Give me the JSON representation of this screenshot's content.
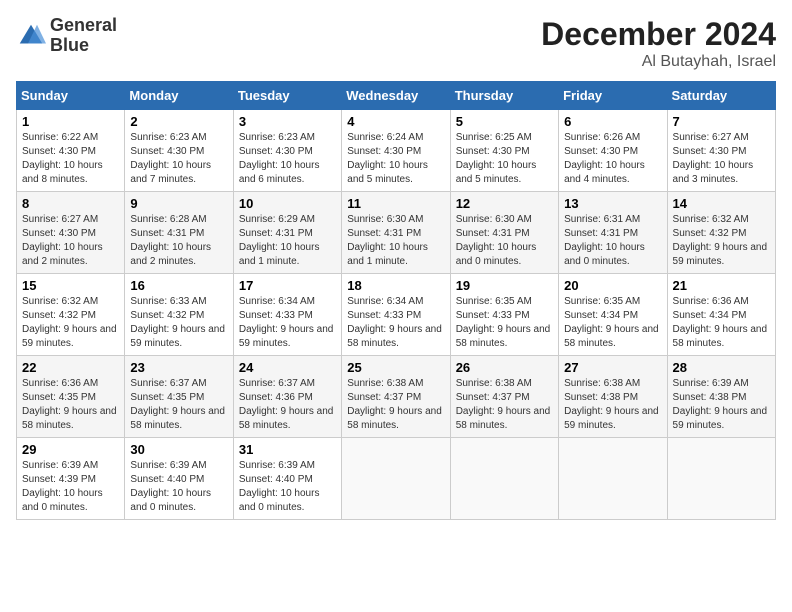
{
  "header": {
    "logo_line1": "General",
    "logo_line2": "Blue",
    "month_year": "December 2024",
    "location": "Al Butayhah, Israel"
  },
  "days_of_week": [
    "Sunday",
    "Monday",
    "Tuesday",
    "Wednesday",
    "Thursday",
    "Friday",
    "Saturday"
  ],
  "weeks": [
    [
      {
        "day": "1",
        "sunrise": "6:22 AM",
        "sunset": "4:30 PM",
        "daylight": "10 hours and 8 minutes."
      },
      {
        "day": "2",
        "sunrise": "6:23 AM",
        "sunset": "4:30 PM",
        "daylight": "10 hours and 7 minutes."
      },
      {
        "day": "3",
        "sunrise": "6:23 AM",
        "sunset": "4:30 PM",
        "daylight": "10 hours and 6 minutes."
      },
      {
        "day": "4",
        "sunrise": "6:24 AM",
        "sunset": "4:30 PM",
        "daylight": "10 hours and 5 minutes."
      },
      {
        "day": "5",
        "sunrise": "6:25 AM",
        "sunset": "4:30 PM",
        "daylight": "10 hours and 5 minutes."
      },
      {
        "day": "6",
        "sunrise": "6:26 AM",
        "sunset": "4:30 PM",
        "daylight": "10 hours and 4 minutes."
      },
      {
        "day": "7",
        "sunrise": "6:27 AM",
        "sunset": "4:30 PM",
        "daylight": "10 hours and 3 minutes."
      }
    ],
    [
      {
        "day": "8",
        "sunrise": "6:27 AM",
        "sunset": "4:30 PM",
        "daylight": "10 hours and 2 minutes."
      },
      {
        "day": "9",
        "sunrise": "6:28 AM",
        "sunset": "4:31 PM",
        "daylight": "10 hours and 2 minutes."
      },
      {
        "day": "10",
        "sunrise": "6:29 AM",
        "sunset": "4:31 PM",
        "daylight": "10 hours and 1 minute."
      },
      {
        "day": "11",
        "sunrise": "6:30 AM",
        "sunset": "4:31 PM",
        "daylight": "10 hours and 1 minute."
      },
      {
        "day": "12",
        "sunrise": "6:30 AM",
        "sunset": "4:31 PM",
        "daylight": "10 hours and 0 minutes."
      },
      {
        "day": "13",
        "sunrise": "6:31 AM",
        "sunset": "4:31 PM",
        "daylight": "10 hours and 0 minutes."
      },
      {
        "day": "14",
        "sunrise": "6:32 AM",
        "sunset": "4:32 PM",
        "daylight": "9 hours and 59 minutes."
      }
    ],
    [
      {
        "day": "15",
        "sunrise": "6:32 AM",
        "sunset": "4:32 PM",
        "daylight": "9 hours and 59 minutes."
      },
      {
        "day": "16",
        "sunrise": "6:33 AM",
        "sunset": "4:32 PM",
        "daylight": "9 hours and 59 minutes."
      },
      {
        "day": "17",
        "sunrise": "6:34 AM",
        "sunset": "4:33 PM",
        "daylight": "9 hours and 59 minutes."
      },
      {
        "day": "18",
        "sunrise": "6:34 AM",
        "sunset": "4:33 PM",
        "daylight": "9 hours and 58 minutes."
      },
      {
        "day": "19",
        "sunrise": "6:35 AM",
        "sunset": "4:33 PM",
        "daylight": "9 hours and 58 minutes."
      },
      {
        "day": "20",
        "sunrise": "6:35 AM",
        "sunset": "4:34 PM",
        "daylight": "9 hours and 58 minutes."
      },
      {
        "day": "21",
        "sunrise": "6:36 AM",
        "sunset": "4:34 PM",
        "daylight": "9 hours and 58 minutes."
      }
    ],
    [
      {
        "day": "22",
        "sunrise": "6:36 AM",
        "sunset": "4:35 PM",
        "daylight": "9 hours and 58 minutes."
      },
      {
        "day": "23",
        "sunrise": "6:37 AM",
        "sunset": "4:35 PM",
        "daylight": "9 hours and 58 minutes."
      },
      {
        "day": "24",
        "sunrise": "6:37 AM",
        "sunset": "4:36 PM",
        "daylight": "9 hours and 58 minutes."
      },
      {
        "day": "25",
        "sunrise": "6:38 AM",
        "sunset": "4:37 PM",
        "daylight": "9 hours and 58 minutes."
      },
      {
        "day": "26",
        "sunrise": "6:38 AM",
        "sunset": "4:37 PM",
        "daylight": "9 hours and 58 minutes."
      },
      {
        "day": "27",
        "sunrise": "6:38 AM",
        "sunset": "4:38 PM",
        "daylight": "9 hours and 59 minutes."
      },
      {
        "day": "28",
        "sunrise": "6:39 AM",
        "sunset": "4:38 PM",
        "daylight": "9 hours and 59 minutes."
      }
    ],
    [
      {
        "day": "29",
        "sunrise": "6:39 AM",
        "sunset": "4:39 PM",
        "daylight": "10 hours and 0 minutes."
      },
      {
        "day": "30",
        "sunrise": "6:39 AM",
        "sunset": "4:40 PM",
        "daylight": "10 hours and 0 minutes."
      },
      {
        "day": "31",
        "sunrise": "6:39 AM",
        "sunset": "4:40 PM",
        "daylight": "10 hours and 0 minutes."
      },
      null,
      null,
      null,
      null
    ]
  ]
}
